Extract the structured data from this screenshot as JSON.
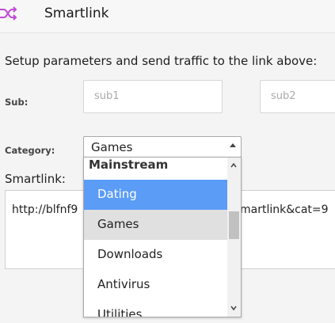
{
  "header": {
    "title": "Smartlink",
    "icon": "shuffle-icon",
    "icon_color": "#c04bd6"
  },
  "intro": "Setup parameters and send traffic to the link above:",
  "sub": {
    "label": "Sub:",
    "field1_placeholder": "sub1",
    "field2_placeholder": "sub2"
  },
  "category": {
    "label": "Category:",
    "selected": "Games",
    "dropdown": {
      "group": "Mainstream",
      "options": [
        "Dating",
        "Games",
        "Downloads",
        "Antivirus",
        "Utilities"
      ],
      "highlighted": "Dating"
    }
  },
  "smartlink": {
    "label": "Smartlink:",
    "url_start": "http://blfnf9",
    "url_end": "martlink&cat=9"
  },
  "colors": {
    "highlight": "#5b9cf7",
    "hover": "#e0e0e0"
  }
}
